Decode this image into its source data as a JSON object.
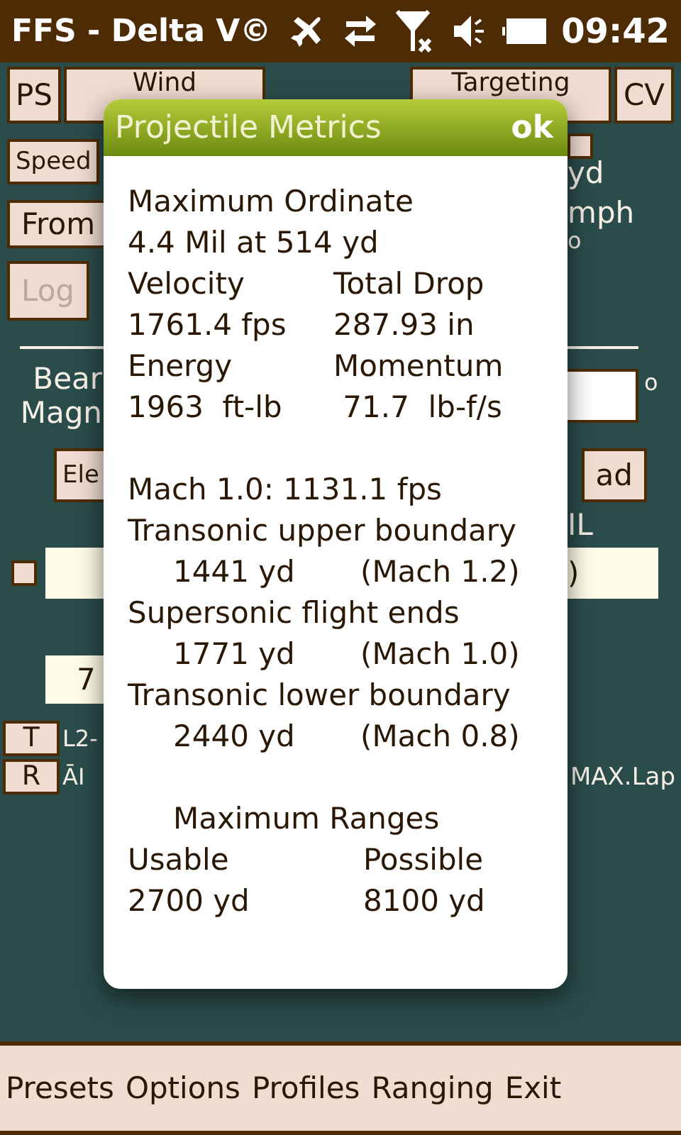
{
  "status_bar": {
    "title": "FFS - Delta V©",
    "time": "09:42"
  },
  "top_buttons": [
    {
      "label": "PS"
    },
    {
      "label": "Wind"
    },
    {
      "label": "Targeting"
    },
    {
      "label": "CV"
    }
  ],
  "form": {
    "speed_button": {
      "label": "Speed",
      "disabled": false
    },
    "yd_checkbox": {
      "checked": false
    },
    "yd_label": "yd",
    "from_button": {
      "label": "From",
      "disabled": false
    },
    "mph_label": "mph",
    "from_degree": "o",
    "log_button": {
      "label": "Log",
      "disabled": true
    },
    "bearing_label": "Bear",
    "magnetic_label": "Magn",
    "bearing_degree": "o",
    "left_button": {
      "label": "Ele",
      "disabled": false
    },
    "right_button": {
      "label": "ad",
      "disabled": false
    },
    "right_caption": "IL",
    "row_checkbox": {
      "checked": false
    },
    "right_field": {
      "value": ")"
    },
    "lower_field": {
      "value": "7"
    },
    "t_button": {
      "label": "T"
    },
    "t_text": "L2-",
    "r_button": {
      "label": "R"
    },
    "r_text": "ĀI",
    "r_right_text": "MAX.Lap"
  },
  "dialog": {
    "title": "Projectile Metrics",
    "ok": "ok",
    "groups": [
      [
        {
          "kind": "text",
          "text": "Maximum Ordinate"
        },
        {
          "kind": "text",
          "text": "4.4 Mil at 514 yd"
        },
        {
          "kind": "pair",
          "cells": [
            "Velocity",
            "Total Drop"
          ]
        },
        {
          "kind": "pair",
          "cells": [
            "1761.4 fps",
            "287.93 in"
          ]
        },
        {
          "kind": "pair",
          "cells": [
            "Energy",
            "Momentum"
          ]
        },
        {
          "kind": "pair",
          "cells": [
            "1963  ft-lb",
            " 71.7  lb-f/s"
          ]
        }
      ],
      [
        {
          "kind": "text",
          "text": "Mach 1.0: 1131.1 fps"
        },
        {
          "kind": "text",
          "text": "Transonic upper boundary"
        },
        {
          "kind": "indent_pair",
          "cells": [
            "1441 yd",
            "(Mach 1.2)"
          ]
        },
        {
          "kind": "text",
          "text": "Supersonic flight ends"
        },
        {
          "kind": "indent_pair",
          "cells": [
            "1771 yd",
            "(Mach 1.0)"
          ]
        },
        {
          "kind": "text",
          "text": "Transonic lower boundary"
        },
        {
          "kind": "indent_pair",
          "cells": [
            "2440 yd",
            "(Mach 0.8)"
          ]
        }
      ],
      [
        {
          "kind": "indent",
          "text": "Maximum Ranges"
        },
        {
          "kind": "wide_pair",
          "cells": [
            "Usable",
            "Possible"
          ]
        },
        {
          "kind": "wide_pair",
          "cells": [
            "2700 yd",
            "8100 yd"
          ]
        }
      ]
    ]
  },
  "menu_bar": [
    {
      "label": "Presets"
    },
    {
      "label": "Options"
    },
    {
      "label": "Profiles"
    },
    {
      "label": "Ranging"
    },
    {
      "label": "Exit"
    }
  ]
}
